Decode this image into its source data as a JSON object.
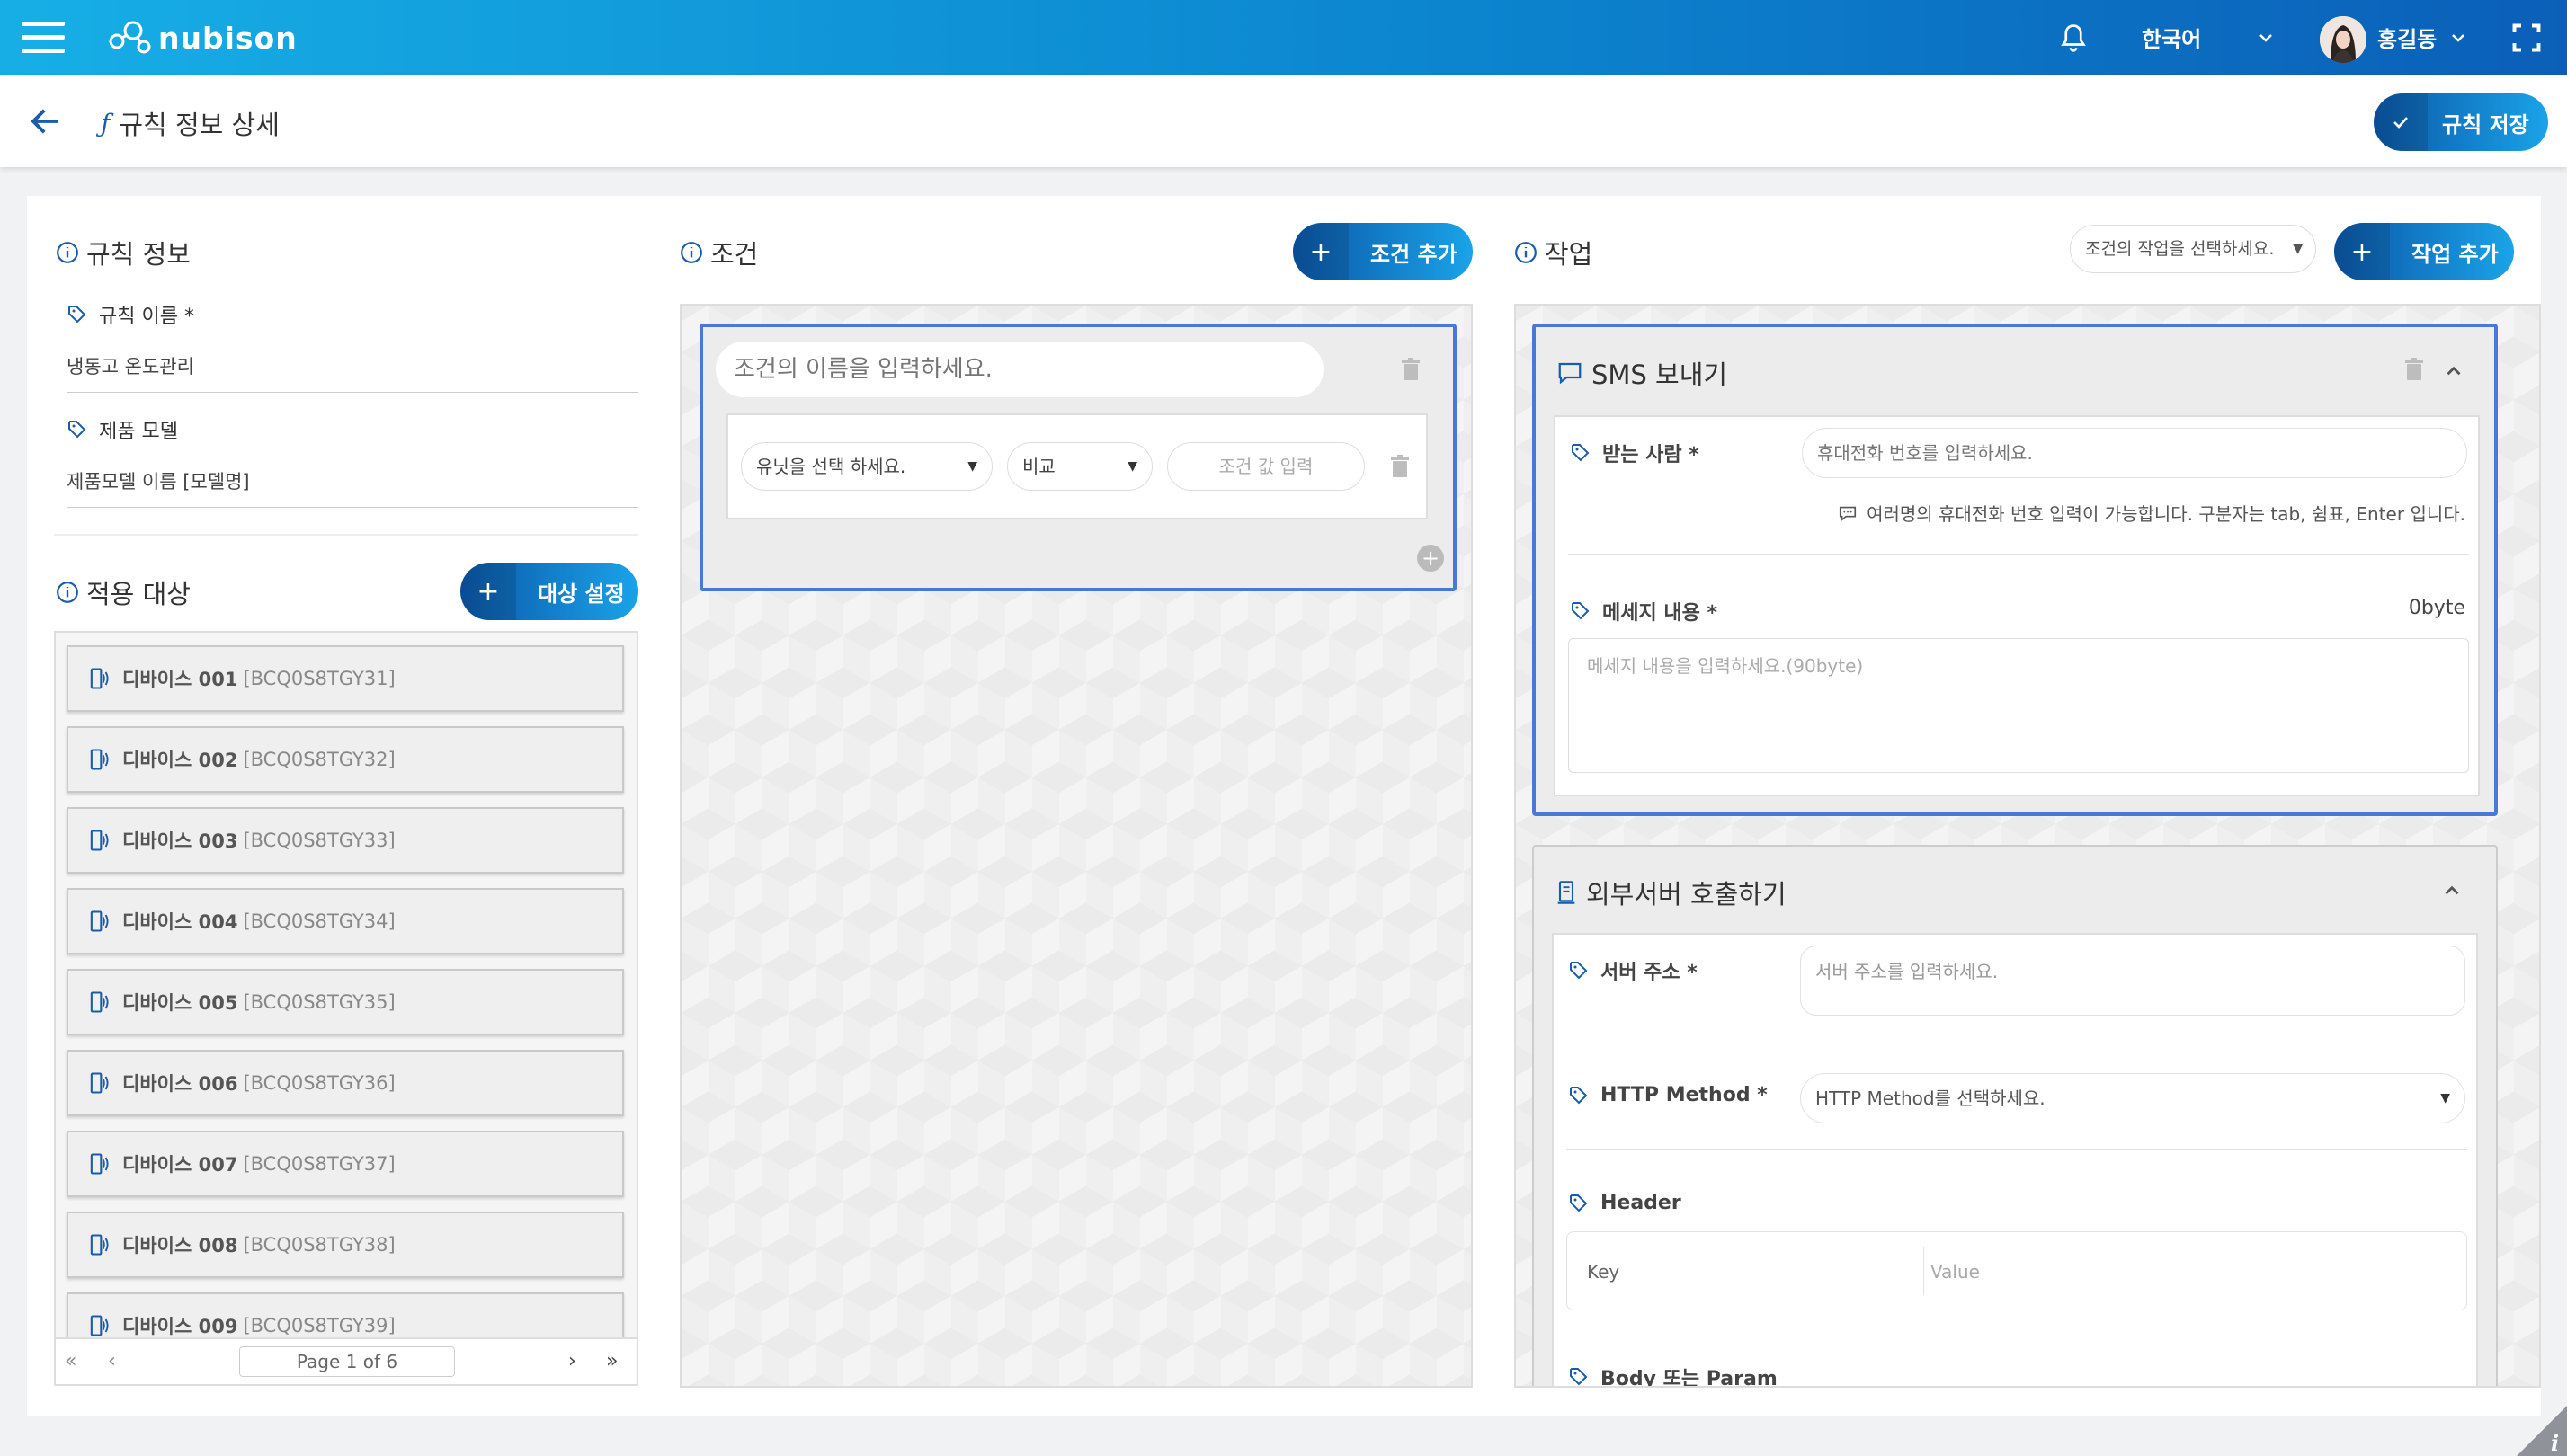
{
  "topbar": {
    "logo_text": "nubison",
    "language": "한국어",
    "user_name": "홍길동"
  },
  "subheader": {
    "title": "규칙 정보 상세",
    "save_label": "규칙 저장"
  },
  "rule_info": {
    "title": "규칙 정보",
    "name_label": "규칙 이름 *",
    "name_value": "냉동고 온도관리",
    "model_label": "제품 모델",
    "model_value": "제품모델 이름 [모델명]"
  },
  "targets": {
    "title": "적용 대상",
    "set_button": "대상 설정",
    "devices": [
      {
        "name": "디바이스 001",
        "code": "[BCQ0S8TGY31]"
      },
      {
        "name": "디바이스 002",
        "code": "[BCQ0S8TGY32]"
      },
      {
        "name": "디바이스 003",
        "code": "[BCQ0S8TGY33]"
      },
      {
        "name": "디바이스 004",
        "code": "[BCQ0S8TGY34]"
      },
      {
        "name": "디바이스 005",
        "code": "[BCQ0S8TGY35]"
      },
      {
        "name": "디바이스 006",
        "code": "[BCQ0S8TGY36]"
      },
      {
        "name": "디바이스 007",
        "code": "[BCQ0S8TGY37]"
      },
      {
        "name": "디바이스 008",
        "code": "[BCQ0S8TGY38]"
      },
      {
        "name": "디바이스 009",
        "code": "[BCQ0S8TGY39]"
      }
    ],
    "pager": "Page 1 of 6"
  },
  "conditions": {
    "title": "조건",
    "add_button": "조건 추가",
    "name_placeholder": "조건의 이름을 입력하세요.",
    "unit_select": "유닛을 선택 하세요.",
    "compare_select": "비교",
    "value_placeholder": "조건 값 입력"
  },
  "actions": {
    "title": "작업",
    "select_placeholder": "조건의 작업을 선택하세요.",
    "add_button": "작업 추가",
    "sms": {
      "title": "SMS 보내기",
      "recipient_label": "받는 사람 *",
      "recipient_placeholder": "휴대전화 번호를 입력하세요.",
      "recipient_help": "여러명의 휴대전화 번호 입력이 가능합니다. 구분자는 tab, 쉼표, Enter 입니다.",
      "message_label": "메세지 내용  *",
      "byte_count": "0byte",
      "message_placeholder": "메세지 내용을 입력하세요.(90byte)"
    },
    "http": {
      "title": "외부서버 호출하기",
      "server_label": "서버 주소 *",
      "server_placeholder": "서버 주소를 입력하세요.",
      "method_label": "HTTP Method *",
      "method_placeholder": "HTTP Method를 선택하세요.",
      "header_label": "Header",
      "key_label": "Key",
      "value_label": "Value",
      "body_label": "Body 또는 Param"
    }
  },
  "colors": {
    "accent": "#1a5ca8",
    "active_border": "#4a78d6"
  }
}
